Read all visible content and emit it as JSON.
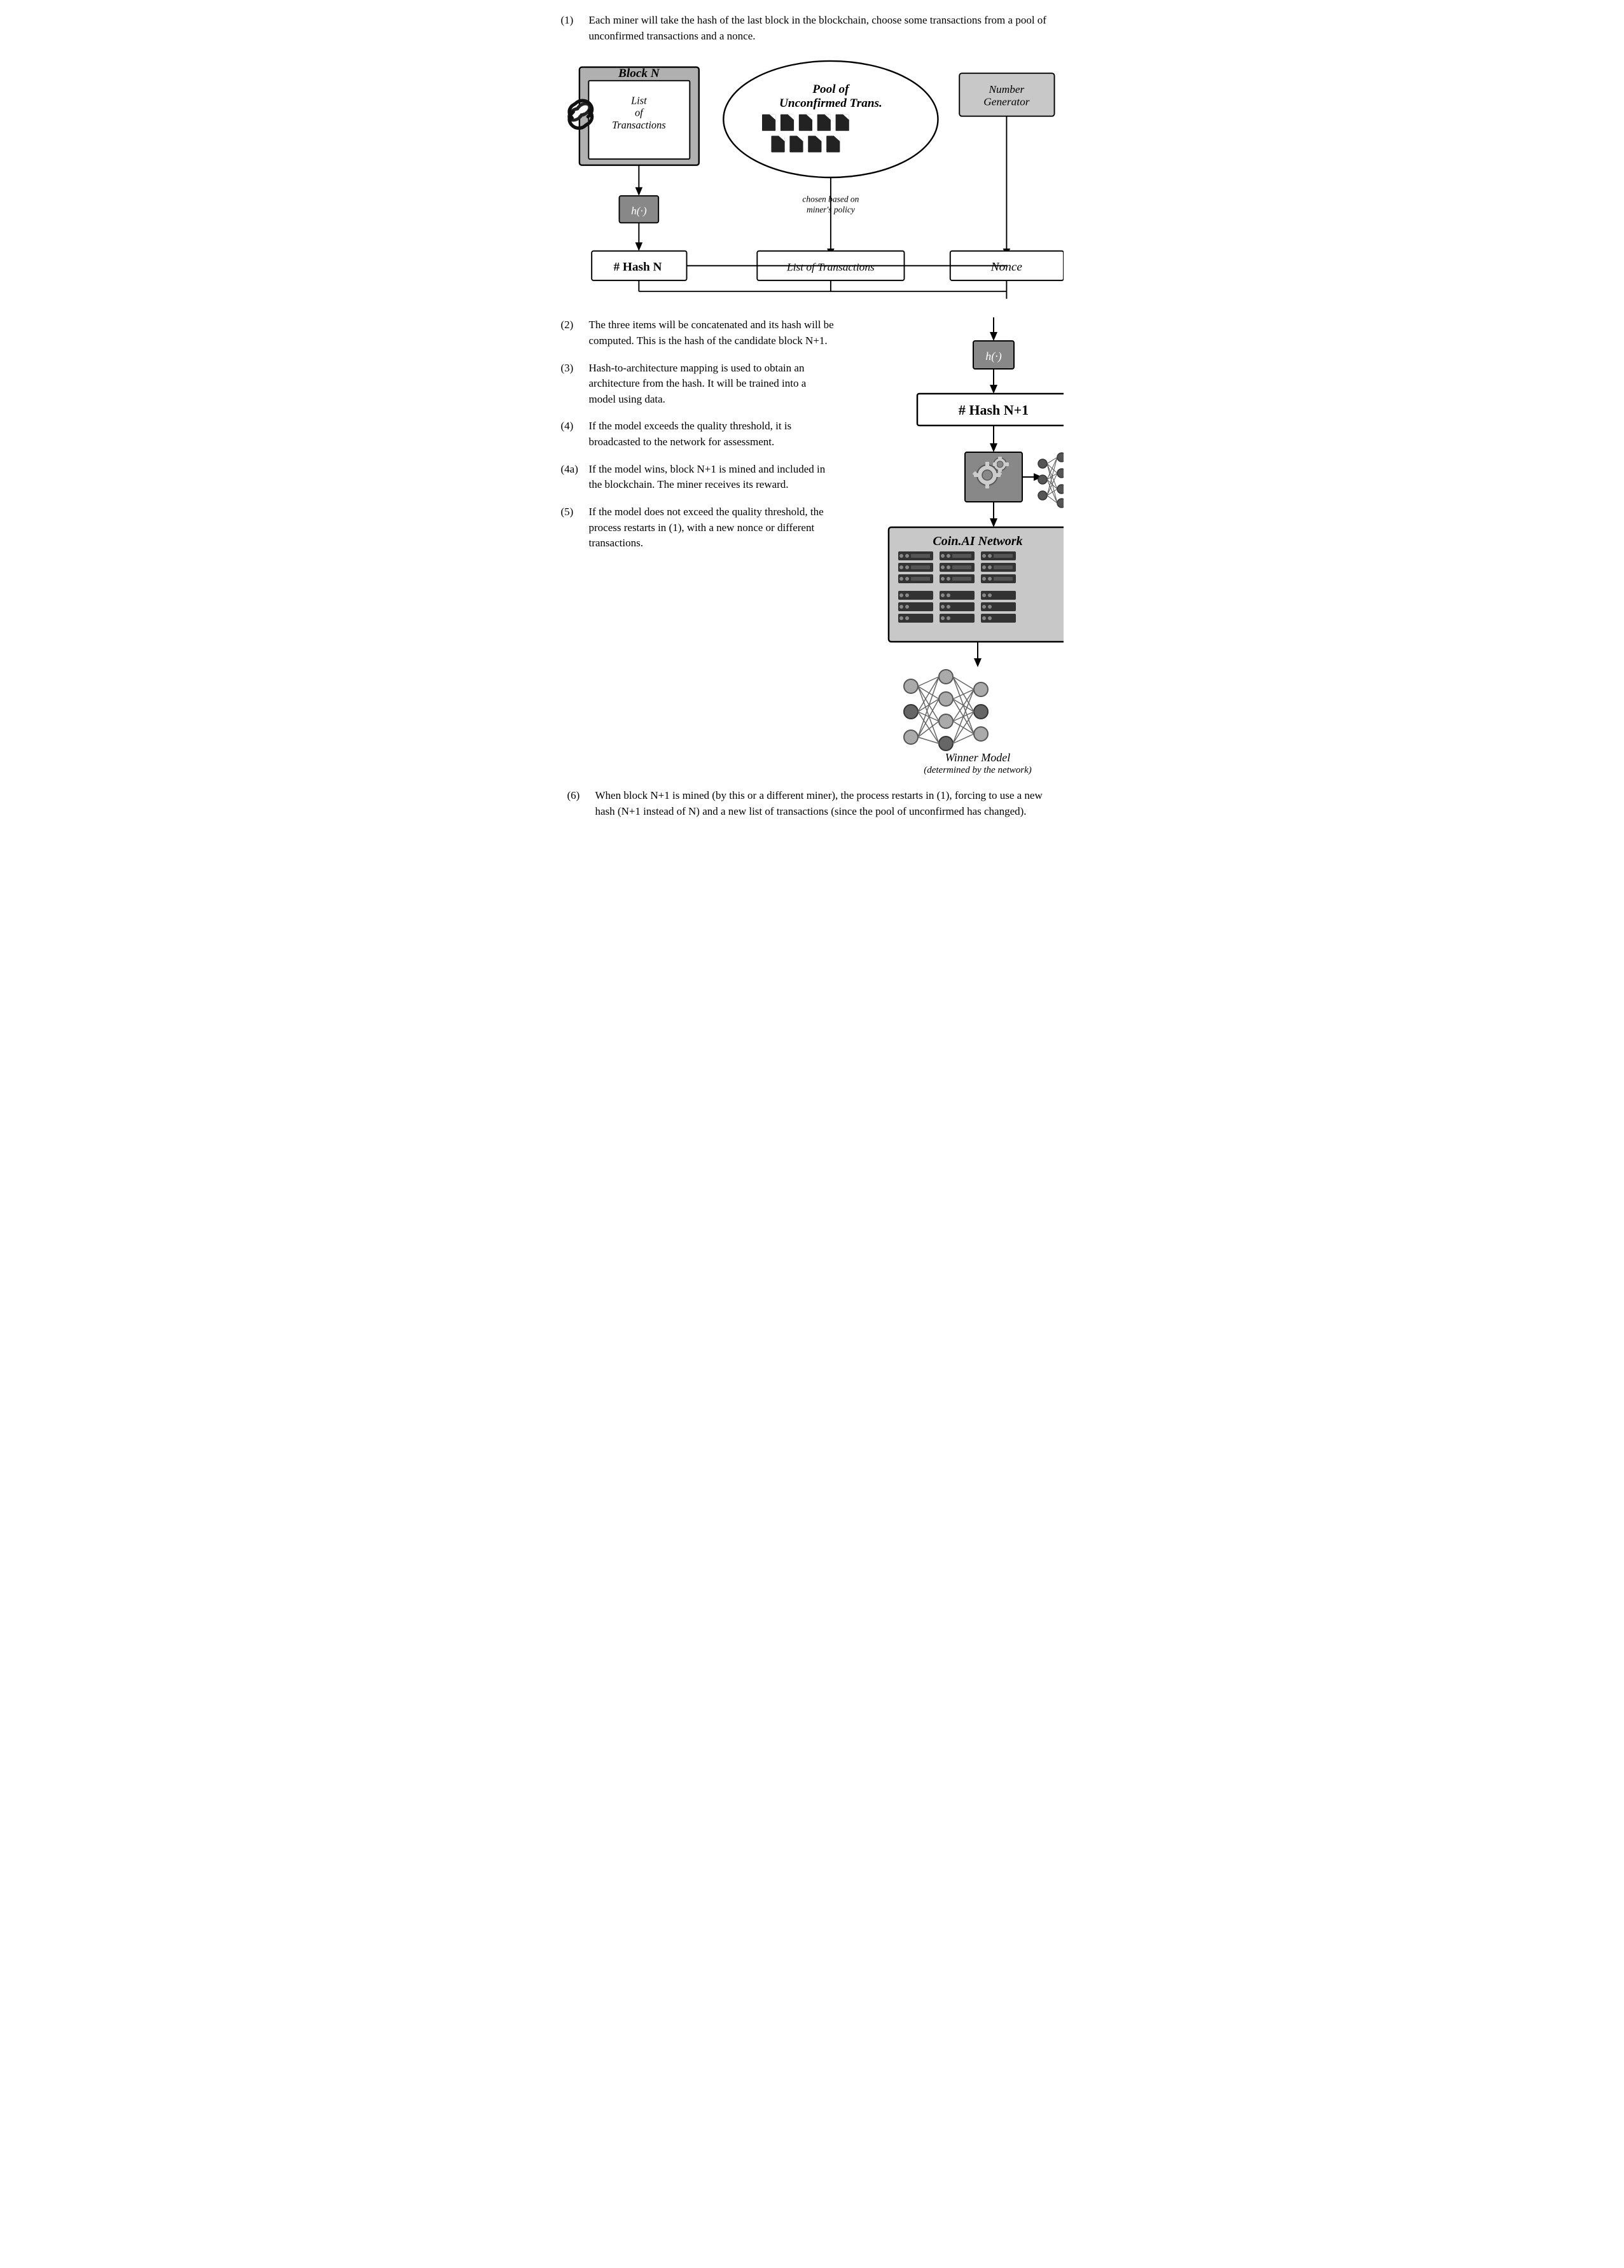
{
  "step1": {
    "text": "Each miner will take the hash of the last block in the blockchain, choose some transactions from a pool of unconfirmed transactions and a nonce."
  },
  "step2": {
    "num": "(2)",
    "text": "The three items will be concatenated and its hash will be computed. This is the hash of the candidate block N+1."
  },
  "step3": {
    "num": "(3)",
    "text": "Hash-to-architecture mapping is used to obtain an architecture from the hash. It will be trained into a model using data."
  },
  "step4": {
    "num": "(4)",
    "text": "If the model exceeds the quality threshold, it is broadcasted to the network for assessment."
  },
  "step4a": {
    "num": "(4a)",
    "text": "If the model wins, block N+1 is mined and included in the blockchain. The miner receives its reward."
  },
  "step5": {
    "num": "(5)",
    "text": "If the model does not exceed the quality threshold, the process restarts in (1), with a new nonce or different transactions."
  },
  "step6": {
    "num": "(6)",
    "text": "When block N+1 is mined (by this or a different miner), the process restarts in (1), forcing to use a new hash (N+1 instead of N) and a new list of transactions (since the pool of unconfirmed has changed)."
  },
  "diagram": {
    "blockN_label": "Block N",
    "list_of_transactions_top": "List of Transactions",
    "pool_label": "Pool of Unconfirmed Trans.",
    "number_generator": "Number Generator",
    "chosen_policy": "chosen based on miner's policy",
    "hash_function": "h(·)",
    "hash_n_label": "# Hash N",
    "list_transactions_mid": "List of Transactions",
    "nonce_label": "Nonce",
    "hash_function2": "h(·)",
    "hash_n1_label": "# Hash N+1",
    "coin_ai_label": "Coin.AI Network",
    "winner_model": "Winner Model",
    "determined": "(determined by the network)"
  }
}
